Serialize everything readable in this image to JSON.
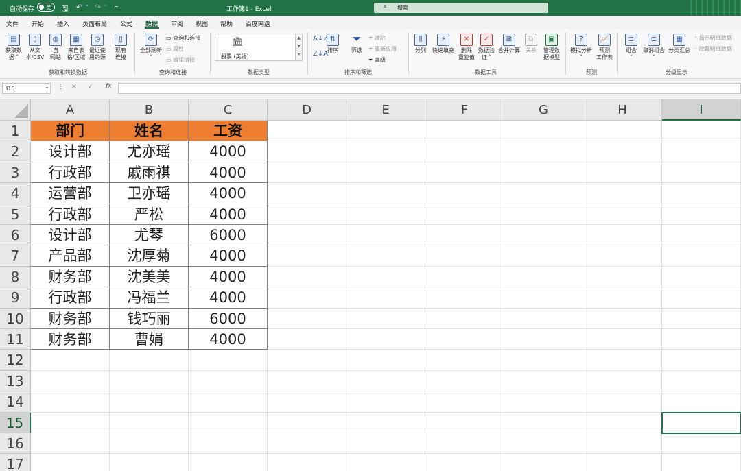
{
  "titlebar": {
    "autosave_label": "自动保存",
    "autosave_state": "关",
    "doc_title": "工作簿1  -  Excel",
    "search_placeholder": "搜索"
  },
  "menu_tabs": [
    "文件",
    "开始",
    "插入",
    "页面布局",
    "公式",
    "数据",
    "审阅",
    "视图",
    "帮助",
    "百度网盘"
  ],
  "active_tab": "数据",
  "ribbon": {
    "groups": {
      "get_transform": "获取和转换数据",
      "queries": "查询和连接",
      "data_types": "数据类型",
      "sort_filter": "排序和筛选",
      "data_tools": "数据工具",
      "forecast": "预测",
      "outline": "分级显示"
    },
    "buttons": {
      "get_data_1": "获取数",
      "get_data_2": "据 ˅",
      "from_csv_1": "从文",
      "from_csv_2": "本/CSV",
      "from_web_1": "自",
      "from_web_2": "网站",
      "from_table_1": "来自表",
      "from_table_2": "格/区域",
      "recent_1": "最近使",
      "recent_2": "用的源",
      "existing_1": "现有",
      "existing_2": "连接",
      "refresh_1": "全部刷新",
      "refresh_2": "˅",
      "queries_conn": "查询和连接",
      "properties": "属性",
      "edit_links": "编辑链接",
      "stocks": "股票 (英语)",
      "sort": "排序",
      "filter": "筛选",
      "clear": "清除",
      "reapply": "重新应用",
      "advanced": "高级",
      "text_to_col": "分列",
      "flash_fill": "快速填充",
      "remove_dup_1": "删除",
      "remove_dup_2": "重复值",
      "validation_1": "数据验",
      "validation_2": "证 ˅",
      "consolidate": "合并计算",
      "relations": "关系",
      "data_model_1": "管理数",
      "data_model_2": "据模型",
      "what_if_1": "模拟分析",
      "what_if_2": "˅",
      "forecast_1": "预测",
      "forecast_2": "工作表",
      "group_1": "组合",
      "group_2": "˅",
      "ungroup_1": "取消组合",
      "ungroup_2": "˅",
      "subtotal": "分类汇总",
      "show_detail": "显示明细数据",
      "hide_detail": "隐藏明细数据"
    }
  },
  "formula_bar": {
    "name_box": "I15",
    "fx": "fx",
    "content": ""
  },
  "columns": [
    "A",
    "B",
    "C",
    "D",
    "E",
    "F",
    "G",
    "H",
    "I"
  ],
  "selected_column": "I",
  "rows": [
    "1",
    "2",
    "3",
    "4",
    "5",
    "6",
    "7",
    "8",
    "9",
    "10",
    "11",
    "12",
    "13",
    "14",
    "15",
    "16",
    "17"
  ],
  "selected_row": "15",
  "table": {
    "header": [
      "部门",
      "姓名",
      "工资"
    ],
    "rows": [
      [
        "设计部",
        "尤亦瑶",
        "4000"
      ],
      [
        "行政部",
        "戚雨祺",
        "4000"
      ],
      [
        "运营部",
        "卫亦瑶",
        "4000"
      ],
      [
        "行政部",
        "严松",
        "4000"
      ],
      [
        "设计部",
        "尤琴",
        "6000"
      ],
      [
        "产品部",
        "沈厚菊",
        "4000"
      ],
      [
        "财务部",
        "沈美美",
        "4000"
      ],
      [
        "行政部",
        "冯福兰",
        "4000"
      ],
      [
        "财务部",
        "钱巧丽",
        "6000"
      ],
      [
        "财务部",
        "曹娟",
        "4000"
      ]
    ]
  },
  "colors": {
    "excel_green": "#217346",
    "header_fill": "#ed7d31"
  }
}
